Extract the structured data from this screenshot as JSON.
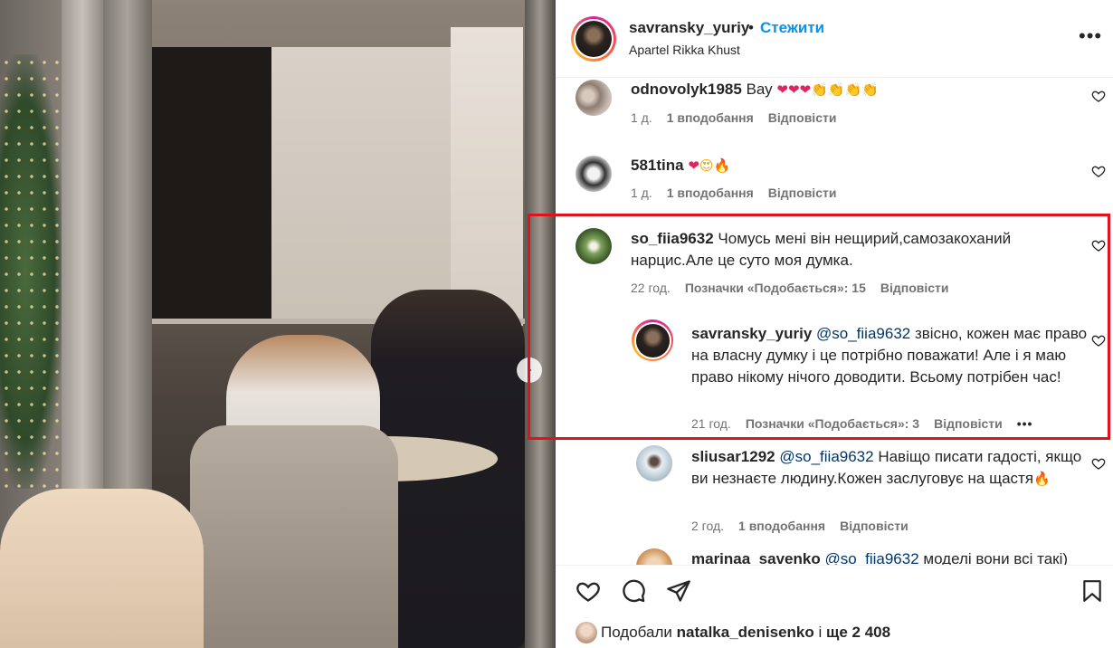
{
  "header": {
    "username": "savransky_yuriy",
    "separator": "•",
    "follow_label": "Стежити",
    "location": "Apartel Rikka Khust",
    "more_icon": "more-horizontal-icon"
  },
  "comments": [
    {
      "user": "odnovolyk1985",
      "text": "Вау",
      "emojis": "❤❤❤👏👏👏👏",
      "time": "1 д.",
      "likes": "1 вподобання",
      "reply": "Відповісти"
    },
    {
      "user": "581tina",
      "text": "",
      "emojis": "❤😍🔥",
      "time": "1 д.",
      "likes": "1 вподобання",
      "reply": "Відповісти"
    },
    {
      "user": "so_fiia9632",
      "text": "Чомусь мені він нещирий,самозакоханий нарцис.Але це суто моя думка.",
      "time": "22 год.",
      "likes": "Позначки «Подобається»: 15",
      "reply": "Відповісти"
    }
  ],
  "replies": [
    {
      "user": "savransky_yuriy",
      "mention": "@so_fiia9632",
      "text": "звісно, кожен має право на власну думку і це потрібно поважати! Але і я маю право нікому нічого доводити. Всьому потрібен час!",
      "time": "21 год.",
      "likes": "Позначки «Подобається»: 3",
      "reply": "Відповісти",
      "more": "•••"
    },
    {
      "user": "sliusar1292",
      "mention": "@so_fiia9632",
      "text": "Навіщо писати гадості, якщо ви незнаєте людину.Кожен заслуговує на щастя",
      "emoji": "🔥",
      "time": "2 год.",
      "likes": "1 вподобання",
      "reply": "Відповісти"
    },
    {
      "user": "marinaa_savenko",
      "mention": "@so_fiia9632",
      "text": "моделі вони всі такі)"
    }
  ],
  "footer": {
    "liked_prefix": "Подобали",
    "liked_user": "natalka_denisenko",
    "liked_middle": "і",
    "liked_rest": "ще 2 408"
  },
  "colors": {
    "link": "#0095f6",
    "mention": "#00376b",
    "highlight_border": "#e0131d",
    "muted": "#737373"
  }
}
